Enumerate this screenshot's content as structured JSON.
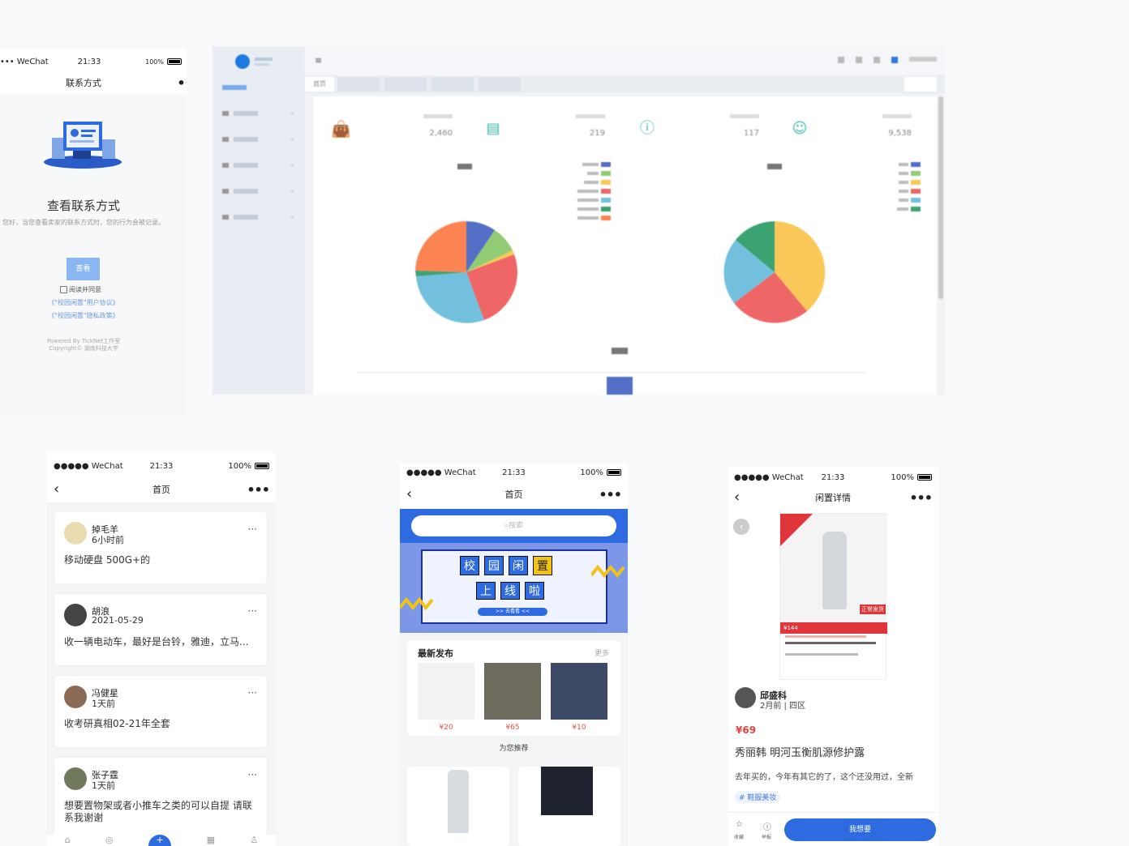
{
  "contact_phone": {
    "status": {
      "carrier": "••• WeChat",
      "time": "21:33",
      "battery": "100%"
    },
    "nav_title": "联系方式",
    "heading": "查看联系方式",
    "desc": "您好，当您查看卖家的联系方式时，您的行为会被记录。",
    "view_button": "查看",
    "agree_label": "阅读并同意",
    "link_user_agreement": "《\"校园闲置\"用户协议》",
    "link_privacy": "《\"校园闲置\"隐私政策》",
    "footer_line1": "Powered By TickNet工作室",
    "footer_line2": "Copyright© 湖南科技大学"
  },
  "admin": {
    "stat_values": [
      "2,460",
      "219",
      "117",
      "9,538"
    ],
    "tab_active": "首页"
  },
  "feed_phone": {
    "status": {
      "carrier": "●●●●● WeChat",
      "time": "21:33",
      "battery": "100%"
    },
    "nav_title": "首页",
    "posts": [
      {
        "name": "掉毛羊",
        "time": "6小时前",
        "text": "移动硬盘 500G+的"
      },
      {
        "name": "胡浪",
        "time": "2021-05-29",
        "text": "收一辆电动车，最好是台铃，雅迪，立马..."
      },
      {
        "name": "冯健星",
        "time": "1天前",
        "text": "收考研真相02-21年全套"
      },
      {
        "name": "张子霆",
        "time": "1天前",
        "text": "想要置物架或者小推车之类的可以自提 请联系我谢谢"
      }
    ]
  },
  "home_phone": {
    "status": {
      "carrier": "●●●●● WeChat",
      "time": "21:33",
      "battery": "100%"
    },
    "nav_title": "首页",
    "search_placeholder": "搜索",
    "banner_row1": [
      "校",
      "园",
      "闲",
      "置"
    ],
    "banner_row2": [
      "上",
      "线",
      "啦"
    ],
    "banner_button": ">> 去看看 <<",
    "latest_title": "最新发布",
    "latest_more": "更多",
    "latest_prices": [
      "¥20",
      "¥65",
      "¥10"
    ],
    "recommend_title": "为您推荐"
  },
  "detail_phone": {
    "status": {
      "carrier": "●●●●● WeChat",
      "time": "21:33",
      "battery": "100%"
    },
    "nav_title": "闲置详情",
    "seller_name": "邱盛科",
    "seller_meta": "2月前 | 四区",
    "price": "¥69",
    "title": "秀丽韩 明河玉衡肌源修护露",
    "desc": "去年买的，今年有其它的了，这个还没用过，全新",
    "tag": "# 鞋服美妆",
    "fav_label": "收藏",
    "report_label": "举报",
    "want_button": "我想要",
    "img_badge": "正常发货",
    "img_price": "¥144"
  }
}
